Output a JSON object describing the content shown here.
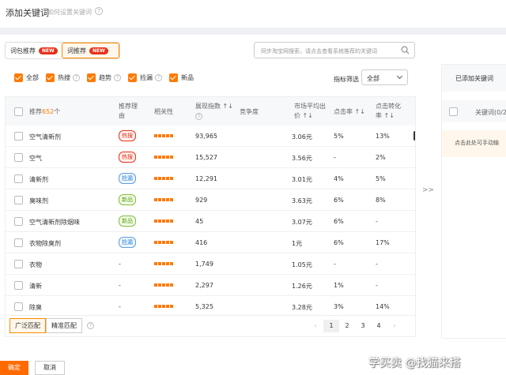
{
  "header": {
    "title": "添加关键词",
    "subtitle": "如何设置关键词"
  },
  "tabs": [
    {
      "label": "词包推荐",
      "badge": "NEW"
    },
    {
      "label": "词推荐",
      "badge": "NEW"
    }
  ],
  "search": {
    "placeholder": "同步淘宝网搜索，请点击查看系统推荐的关键词"
  },
  "filters": [
    {
      "label": "全部",
      "checked": true
    },
    {
      "label": "热搜",
      "checked": true
    },
    {
      "label": "趋势",
      "checked": true
    },
    {
      "label": "捡漏",
      "checked": true
    },
    {
      "label": "新品",
      "checked": true
    }
  ],
  "screening": {
    "label": "指标筛选",
    "value": "全部"
  },
  "table": {
    "headers": {
      "recommend_prefix": "推荐",
      "recommend_count": "652",
      "recommend_suffix": "个",
      "reason": "推荐理由",
      "relevance": "相关性",
      "impressions": "展现指数",
      "competition": "竞争度",
      "price": "市场平均出价",
      "ctr": "点击率",
      "cvr": "点击转化率"
    },
    "rows": [
      {
        "keyword": "空气清新剂",
        "tag": "热搜",
        "tag_type": "hot",
        "impressions": "93,965",
        "price": "3.06元",
        "ctr": "5%",
        "cvr": "13%"
      },
      {
        "keyword": "空气",
        "tag": "热搜",
        "tag_type": "hot",
        "impressions": "15,527",
        "price": "3.56元",
        "ctr": "-",
        "cvr": "2%"
      },
      {
        "keyword": "清新剂",
        "tag": "捡漏",
        "tag_type": "pick",
        "impressions": "12,291",
        "price": "3.01元",
        "ctr": "4%",
        "cvr": "5%"
      },
      {
        "keyword": "臭味剂",
        "tag": "新品",
        "tag_type": "new",
        "impressions": "929",
        "price": "3.63元",
        "ctr": "6%",
        "cvr": "8%"
      },
      {
        "keyword": "空气清新剂除烟味",
        "tag": "新品",
        "tag_type": "new",
        "impressions": "45",
        "price": "3.07元",
        "ctr": "6%",
        "cvr": "-"
      },
      {
        "keyword": "衣物除臭剂",
        "tag": "捡漏",
        "tag_type": "pick",
        "impressions": "416",
        "price": "1元",
        "ctr": "6%",
        "cvr": "17%"
      },
      {
        "keyword": "衣物",
        "tag": "-",
        "tag_type": "none",
        "impressions": "1,749",
        "price": "1.05元",
        "ctr": "-",
        "cvr": "-"
      },
      {
        "keyword": "清新",
        "tag": "-",
        "tag_type": "none",
        "impressions": "2,297",
        "price": "1.26元",
        "ctr": "1%",
        "cvr": "-"
      },
      {
        "keyword": "除臭",
        "tag": "-",
        "tag_type": "none",
        "impressions": "5,325",
        "price": "3.28元",
        "ctr": "3%",
        "cvr": "14%"
      }
    ]
  },
  "match": {
    "broad": "广泛匹配",
    "exact": "精准匹配"
  },
  "pagination": {
    "pages": [
      "1",
      "2",
      "3",
      "4"
    ],
    "current": "1",
    "prev": "‹",
    "next": "›"
  },
  "transfer_arrows": ">>",
  "right_panel": {
    "title": "已添加关键词",
    "col_header": "关键词(0/2",
    "hint": "点击此处可手动输"
  },
  "footer": {
    "ok": "确定",
    "cancel": "取消"
  },
  "watermark": "学买卖 @找猫来搭"
}
